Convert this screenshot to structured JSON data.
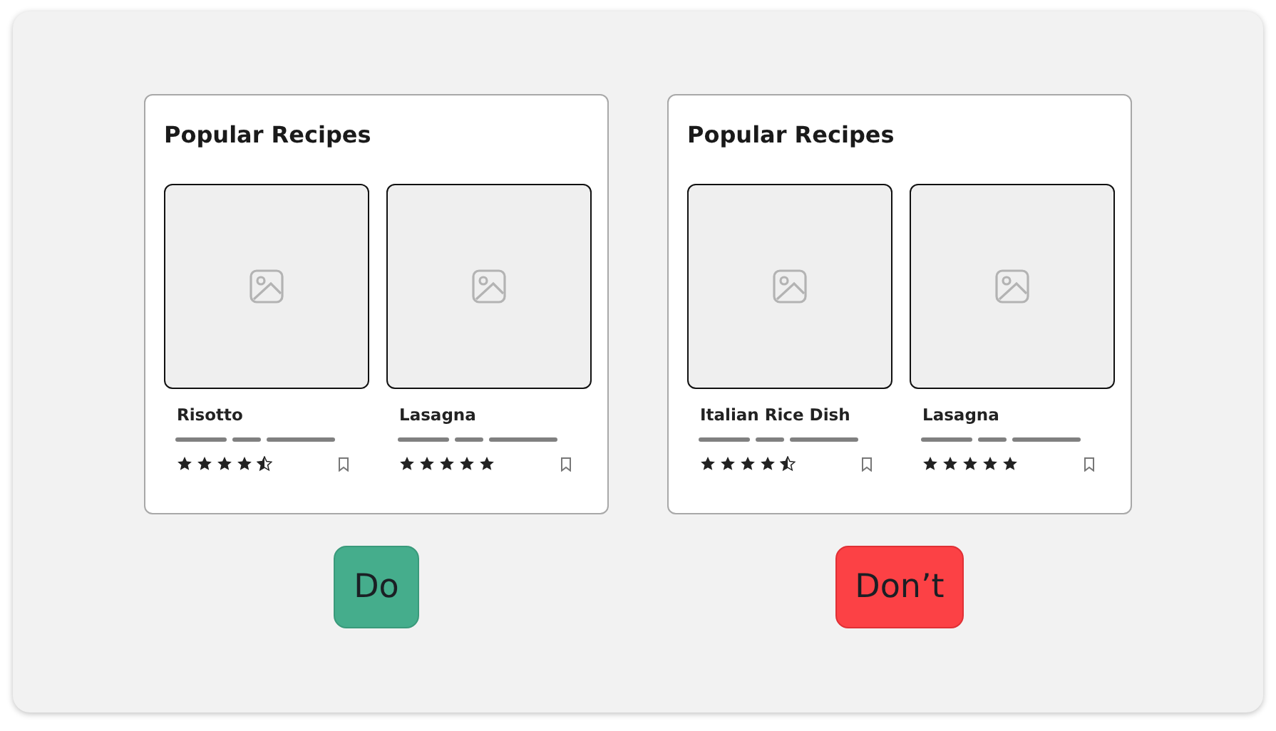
{
  "examples": [
    {
      "title": "Popular Recipes",
      "recipes": [
        {
          "name": "Risotto",
          "stars": 4.5,
          "bookmarked": false
        },
        {
          "name": "Lasagna",
          "stars": 5,
          "bookmarked": false
        }
      ],
      "verdict": {
        "kind": "do",
        "label": "Do"
      }
    },
    {
      "title": "Popular Recipes",
      "recipes": [
        {
          "name": "Italian Rice Dish",
          "stars": 4.5,
          "bookmarked": false
        },
        {
          "name": "Lasagna",
          "stars": 5,
          "bookmarked": false
        }
      ],
      "verdict": {
        "kind": "dont",
        "label": "Don’t"
      }
    }
  ]
}
